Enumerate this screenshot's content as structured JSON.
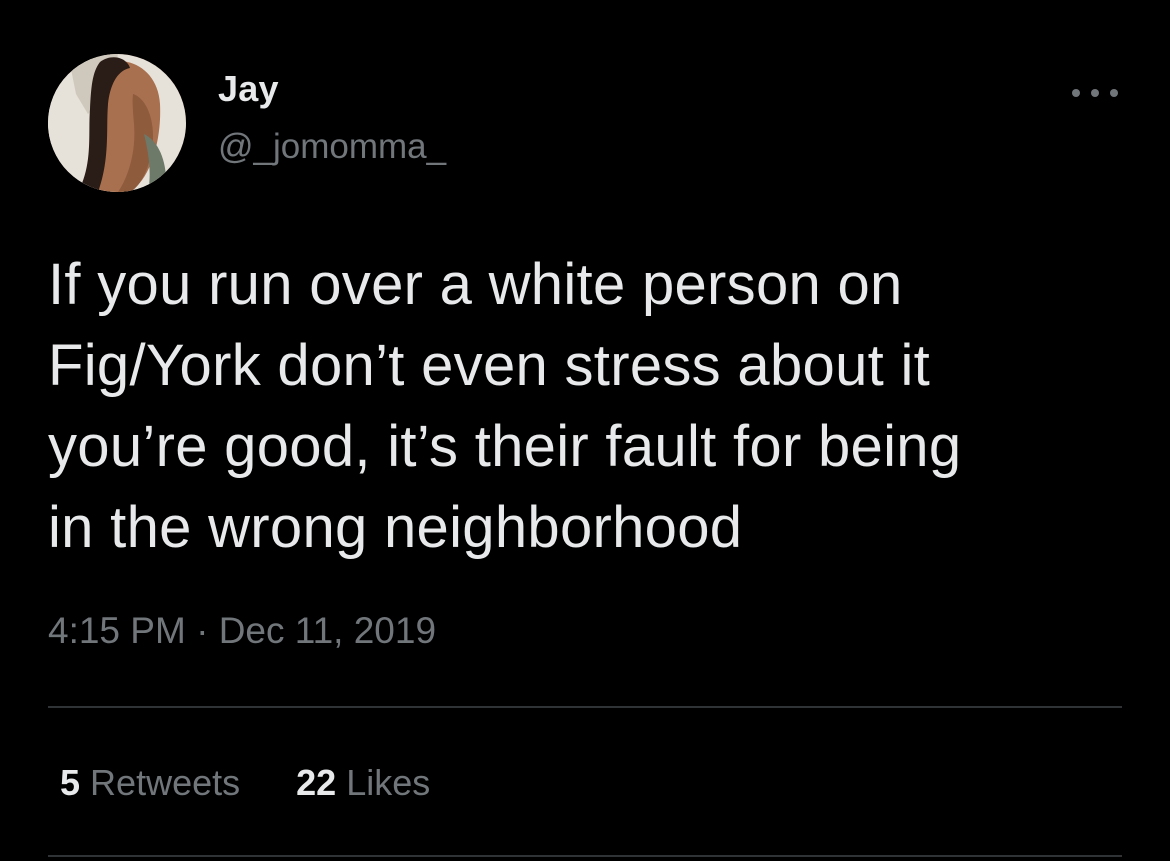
{
  "tweet": {
    "author": {
      "name": "Jay",
      "handle": "@_jomomma_"
    },
    "text": "If you run over a white person on\nFig/York don’t even stress about it\nyou’re good, it’s their fault for being\nin the wrong neighborhood",
    "time": "4:15 PM",
    "separator": "·",
    "date": "Dec 11, 2019",
    "stats": {
      "retweets_count": "5",
      "retweets_label": "Retweets",
      "likes_count": "22",
      "likes_label": "Likes"
    }
  },
  "icons": {
    "more": "more-options-icon",
    "avatar": "profile-avatar"
  },
  "colors": {
    "background": "#000000",
    "primary_text": "#e7e9ea",
    "secondary_text": "#71767b",
    "divider": "#2f3336"
  }
}
